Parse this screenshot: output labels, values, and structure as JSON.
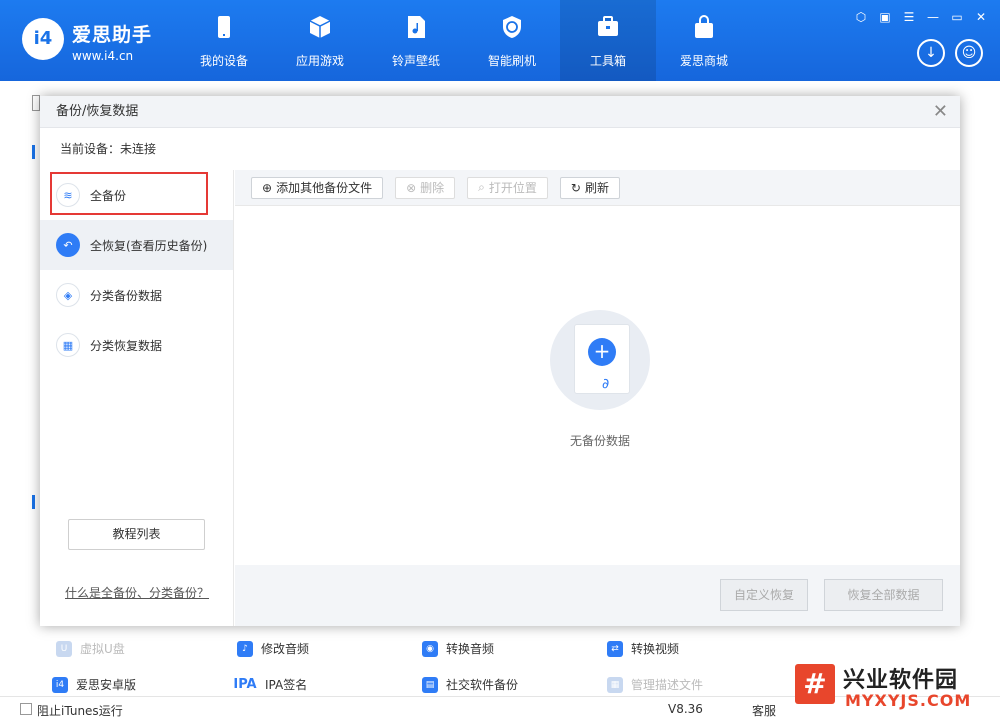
{
  "app": {
    "name": "爱思助手",
    "url": "www.i4.cn",
    "logo": "i4"
  },
  "nav": [
    {
      "label": "我的设备",
      "icon": "phone-icon"
    },
    {
      "label": "应用游戏",
      "icon": "cube-icon"
    },
    {
      "label": "铃声壁纸",
      "icon": "music-file-icon"
    },
    {
      "label": "智能刷机",
      "icon": "refresh-shield-icon"
    },
    {
      "label": "工具箱",
      "icon": "toolbox-icon",
      "active": true
    },
    {
      "label": "爱思商城",
      "icon": "shopping-bag-icon"
    }
  ],
  "window_controls": [
    "⬡",
    "▣",
    "☰",
    "—",
    "▭",
    "✕"
  ],
  "background_tools": [
    [
      {
        "label": "虚拟U盘",
        "dim": true,
        "icon": "U"
      },
      {
        "label": "修改音频",
        "icon": "♪"
      },
      {
        "label": "转换音频",
        "icon": "◉"
      },
      {
        "label": "转换视频",
        "icon": "⇄"
      }
    ],
    [
      {
        "label": "爱思安卓版",
        "icon": "i4"
      },
      {
        "label": "IPA签名",
        "icon": "IPA"
      },
      {
        "label": "社交软件备份",
        "icon": "▤"
      },
      {
        "label": "管理描述文件",
        "dim": true,
        "icon": "▦"
      }
    ]
  ],
  "status": {
    "itunes": "阻止iTunes运行",
    "version": "V8.36",
    "service": "客服"
  },
  "dialog": {
    "title": "备份/恢复数据",
    "close": "✕",
    "device_label": "当前设备：未连接",
    "side_items": [
      {
        "label": "全备份",
        "icon": "≋"
      },
      {
        "label": "全恢复(查看历史备份)",
        "icon": "↶"
      },
      {
        "label": "分类备份数据",
        "icon": "◈"
      },
      {
        "label": "分类恢复数据",
        "icon": "▦"
      }
    ],
    "tutorial_button": "教程列表",
    "help_link": "什么是全备份、分类备份？",
    "toolbar": {
      "add": "添加其他备份文件",
      "delete": "删除",
      "open_location": "打开位置",
      "refresh": "刷新"
    },
    "empty_text": "无备份数据",
    "custom_restore": "自定义恢复",
    "restore_all": "恢复全部数据"
  },
  "watermark": {
    "title": "兴业软件园",
    "domain": "MYXYJS.COM",
    "mark": "#"
  }
}
